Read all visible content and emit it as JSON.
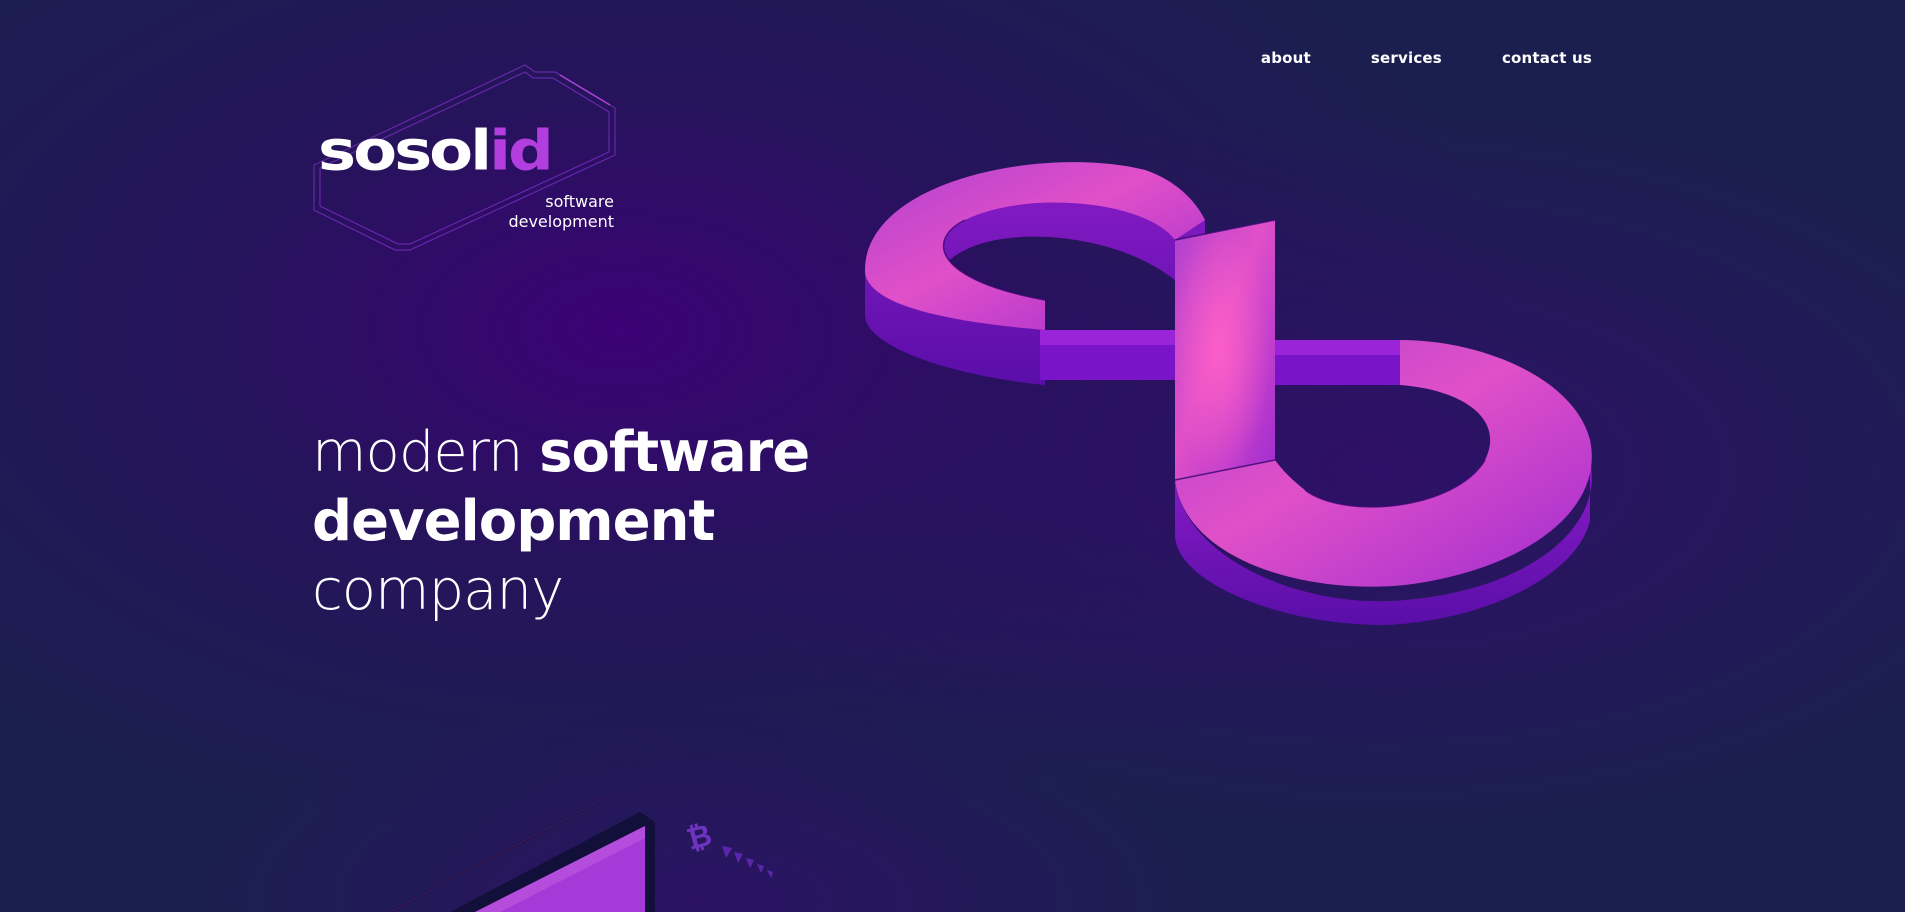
{
  "nav": {
    "items": [
      {
        "label": "about"
      },
      {
        "label": "services"
      },
      {
        "label": "contact us"
      }
    ]
  },
  "logo": {
    "wordmark_white": "sosol",
    "wordmark_accent": "id",
    "tagline_line1": "software",
    "tagline_line2": "development"
  },
  "hero": {
    "line1_light": "modern ",
    "line1_bold": "software",
    "line2_bold": "development",
    "line3_light": "company"
  },
  "colors": {
    "background": "#1b1f4f",
    "accent": "#b23ee0",
    "text": "#ffffff"
  },
  "icons": {
    "infinity": "infinity-illustration",
    "laptop": "laptop-illustration",
    "bitcoin": "bitcoin-icon"
  }
}
